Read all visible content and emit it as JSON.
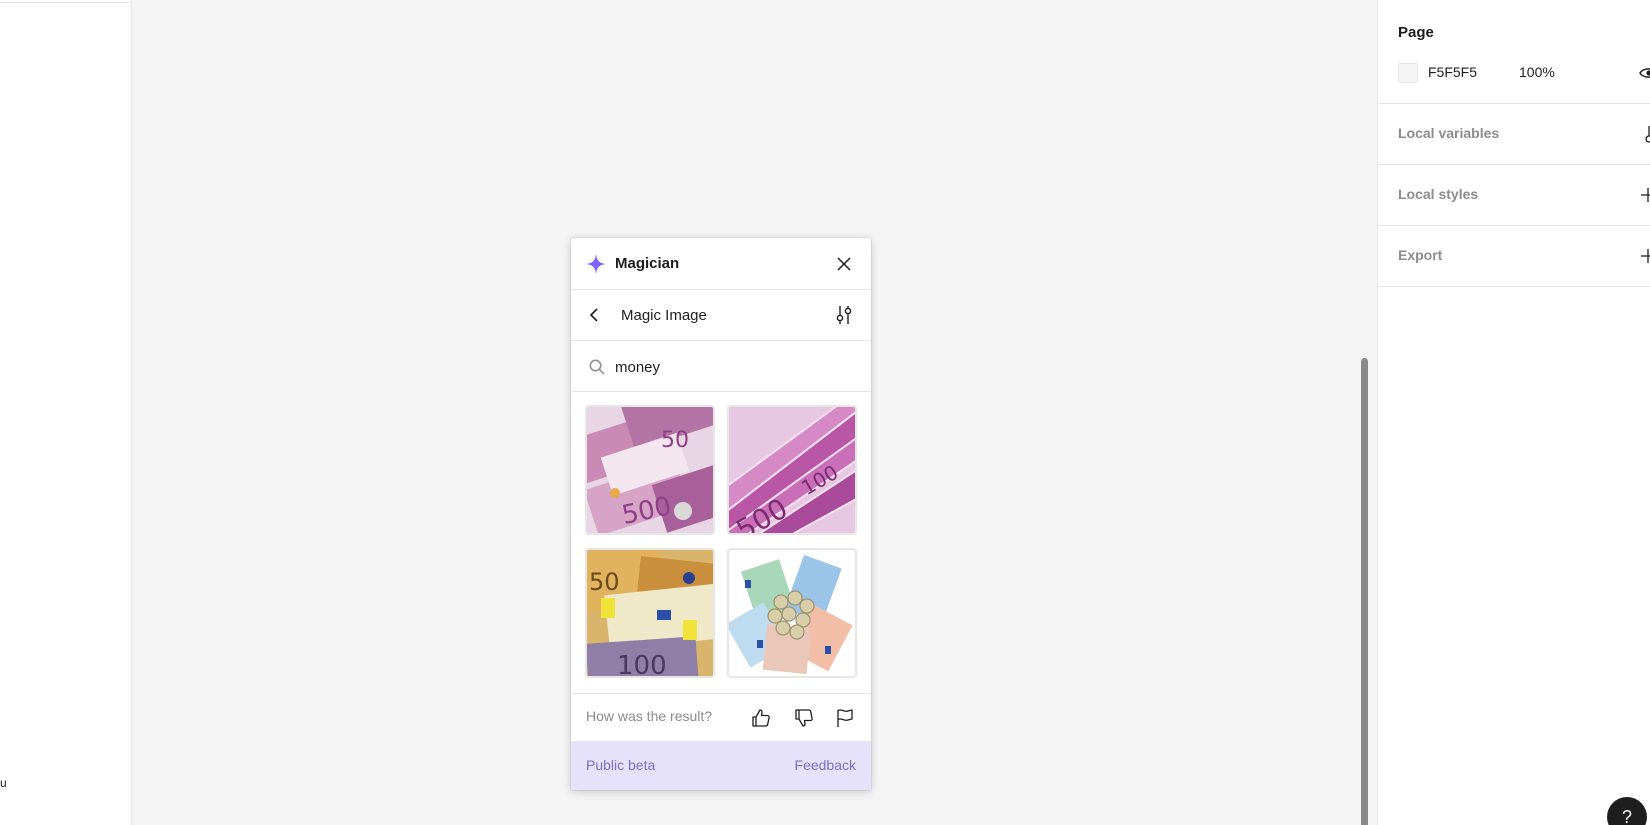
{
  "left_panel": {
    "stray_text": "u"
  },
  "right_panel": {
    "page": {
      "title": "Page",
      "fill_hex": "F5F5F5",
      "opacity": "100%",
      "visibility_icon": "eye-icon"
    },
    "sections": [
      {
        "label": "Local variables",
        "action_icon": "variables-icon"
      },
      {
        "label": "Local styles",
        "action_icon": "plus-icon"
      },
      {
        "label": "Export",
        "action_icon": "plus-icon"
      }
    ]
  },
  "magician": {
    "title": "Magician",
    "logo_icon": "sparkle-icon",
    "subtitle": "Magic Image",
    "search": {
      "value": "money",
      "placeholder": ""
    },
    "results": [
      {
        "name": "500-euro-notes-image"
      },
      {
        "name": "fanned-500-euro-notes-image"
      },
      {
        "name": "50-100-euro-notes-image"
      },
      {
        "name": "euro-notes-and-coins-image"
      }
    ],
    "feedback": {
      "question": "How was the result?"
    },
    "footer": {
      "beta_label": "Public beta",
      "feedback_label": "Feedback"
    },
    "colors": {
      "accent": "#7B61FF",
      "footer_bg": "#E7E2FB",
      "footer_text": "#7F6EC8"
    }
  },
  "help": {
    "label": "?"
  }
}
